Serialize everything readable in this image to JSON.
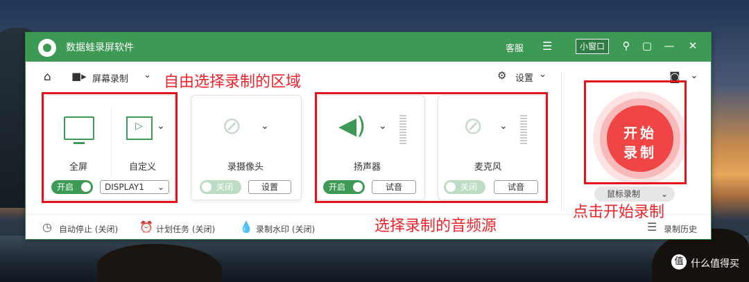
{
  "app": {
    "title": "数据蛙录屏软件",
    "service": "客服",
    "mini_window": "小窗口",
    "accent": "#3d9a55",
    "record_color": "#ef4545"
  },
  "toolbar": {
    "mode_label": "屏幕录制",
    "settings_label": "设置"
  },
  "screen_card": {
    "fullscreen_label": "全屏",
    "custom_label": "自定义",
    "toggle_label": "开启",
    "display_value": "DISPLAY1"
  },
  "camera_card": {
    "label": "录摄像头",
    "toggle_label": "关闭",
    "settings_button": "设置"
  },
  "speaker_card": {
    "label": "扬声器",
    "toggle_label": "开启",
    "test_button": "试音"
  },
  "mic_card": {
    "label": "麦克风",
    "toggle_label": "关闭",
    "test_button": "试音"
  },
  "record": {
    "line1": "开始",
    "line2": "录制",
    "mouse_record": "鼠标录制"
  },
  "bottom": {
    "auto_stop": "自动停止 (关闭)",
    "scheduled": "计划任务 (关闭)",
    "watermark": "录制水印 (关闭)",
    "history": "录制历史"
  },
  "annotations": {
    "region": "自由选择录制的区域",
    "audio": "选择录制的音频源",
    "start": "点击开始录制"
  },
  "watermark_site": "什么值得买"
}
